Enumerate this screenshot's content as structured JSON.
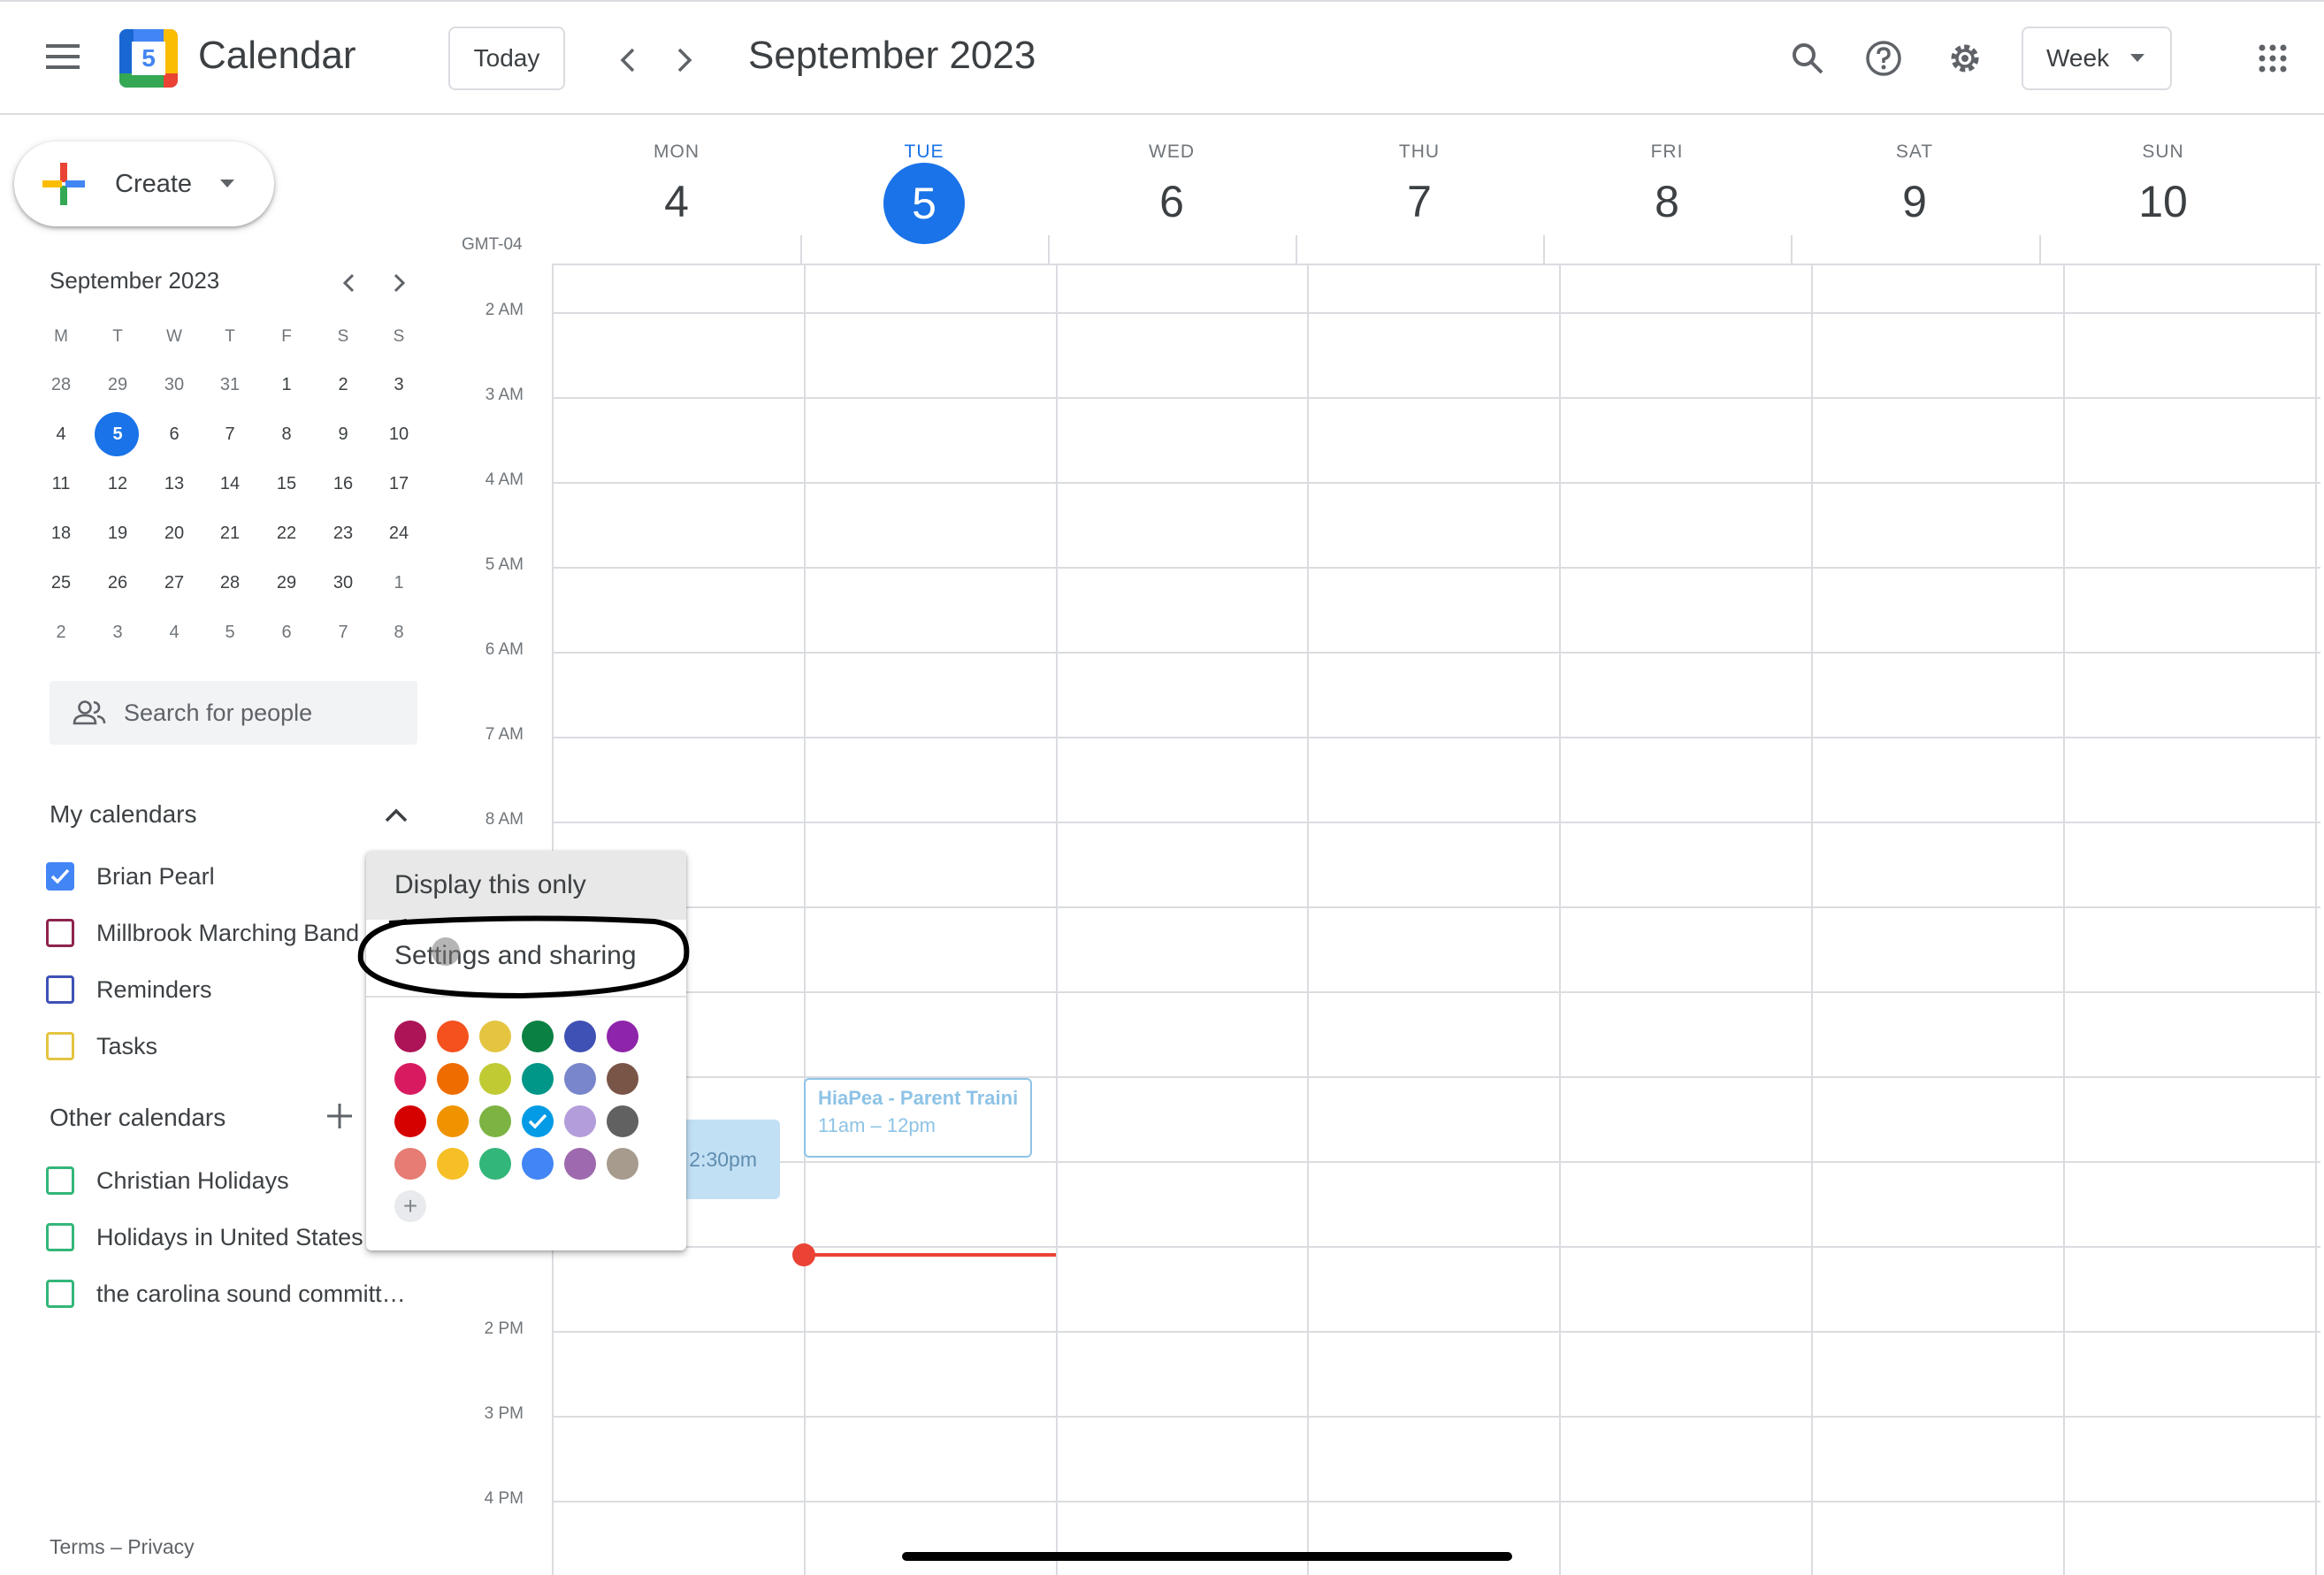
{
  "header": {
    "app_title": "Calendar",
    "logo_day": "5",
    "today_label": "Today",
    "current_range": "September 2023",
    "view_label": "Week"
  },
  "sidebar": {
    "create_label": "Create",
    "mini_calendar": {
      "title": "September 2023",
      "weekday_headers": [
        "M",
        "T",
        "W",
        "T",
        "F",
        "S",
        "S"
      ],
      "weeks": [
        [
          "28",
          "29",
          "30",
          "31",
          "1",
          "2",
          "3"
        ],
        [
          "4",
          "5",
          "6",
          "7",
          "8",
          "9",
          "10"
        ],
        [
          "11",
          "12",
          "13",
          "14",
          "15",
          "16",
          "17"
        ],
        [
          "18",
          "19",
          "20",
          "21",
          "22",
          "23",
          "24"
        ],
        [
          "25",
          "26",
          "27",
          "28",
          "29",
          "30",
          "1"
        ],
        [
          "2",
          "3",
          "4",
          "5",
          "6",
          "7",
          "8"
        ]
      ],
      "selected_day": "5"
    },
    "search_placeholder": "Search for people",
    "my_calendars_title": "My calendars",
    "my_calendars": [
      {
        "label": "Brian Pearl",
        "color": "#4285f4",
        "checked": true
      },
      {
        "label": "Millbrook Marching Band",
        "color": "#8e244d",
        "checked": false
      },
      {
        "label": "Reminders",
        "color": "#3f51b5",
        "checked": false
      },
      {
        "label": "Tasks",
        "color": "#e4c441",
        "checked": false
      }
    ],
    "other_calendars_title": "Other calendars",
    "other_calendars": [
      {
        "label": "Christian Holidays",
        "color": "#33b679",
        "checked": false
      },
      {
        "label": "Holidays in United States",
        "color": "#33b679",
        "checked": false
      },
      {
        "label": "the carolina sound committ…",
        "color": "#33b679",
        "checked": false
      }
    ],
    "footer_terms": "Terms",
    "footer_sep": "–",
    "footer_privacy": "Privacy"
  },
  "week": {
    "timezone": "GMT-04",
    "days": [
      {
        "name": "MON",
        "num": "4",
        "today": false
      },
      {
        "name": "TUE",
        "num": "5",
        "today": true
      },
      {
        "name": "WED",
        "num": "6",
        "today": false
      },
      {
        "name": "THU",
        "num": "7",
        "today": false
      },
      {
        "name": "FRI",
        "num": "8",
        "today": false
      },
      {
        "name": "SAT",
        "num": "9",
        "today": false
      },
      {
        "name": "SUN",
        "num": "10",
        "today": false
      }
    ],
    "hours": [
      "2 AM",
      "3 AM",
      "4 AM",
      "5 AM",
      "6 AM",
      "7 AM",
      "8 AM",
      "",
      "",
      "",
      "",
      "",
      "2 PM",
      "3 PM",
      "4 PM"
    ],
    "events": [
      {
        "title": "HiaPea - Parent Traini",
        "time": "11am – 12pm"
      },
      {
        "title": "",
        "time": "2:30pm"
      }
    ]
  },
  "context_menu": {
    "display_only": "Display this only",
    "settings_sharing": "Settings and sharing",
    "colors": [
      [
        "#ad1457",
        "#f4511e",
        "#e4c441",
        "#0b8043",
        "#3f51b5",
        "#8e24aa"
      ],
      [
        "#d81b60",
        "#ef6c00",
        "#c0ca33",
        "#009688",
        "#7986cb",
        "#795548"
      ],
      [
        "#d50000",
        "#f09300",
        "#7cb342",
        "#039be5",
        "#b39ddb",
        "#616161"
      ],
      [
        "#e67c73",
        "#f6bf26",
        "#33b679",
        "#4285f4",
        "#9e69af",
        "#a79b8e"
      ]
    ],
    "selected_color": "#039be5",
    "add_color_label": "+"
  },
  "colors": {
    "accent": "#1a73e8",
    "current_time": "#ea4335",
    "grid": "#dadce0"
  }
}
